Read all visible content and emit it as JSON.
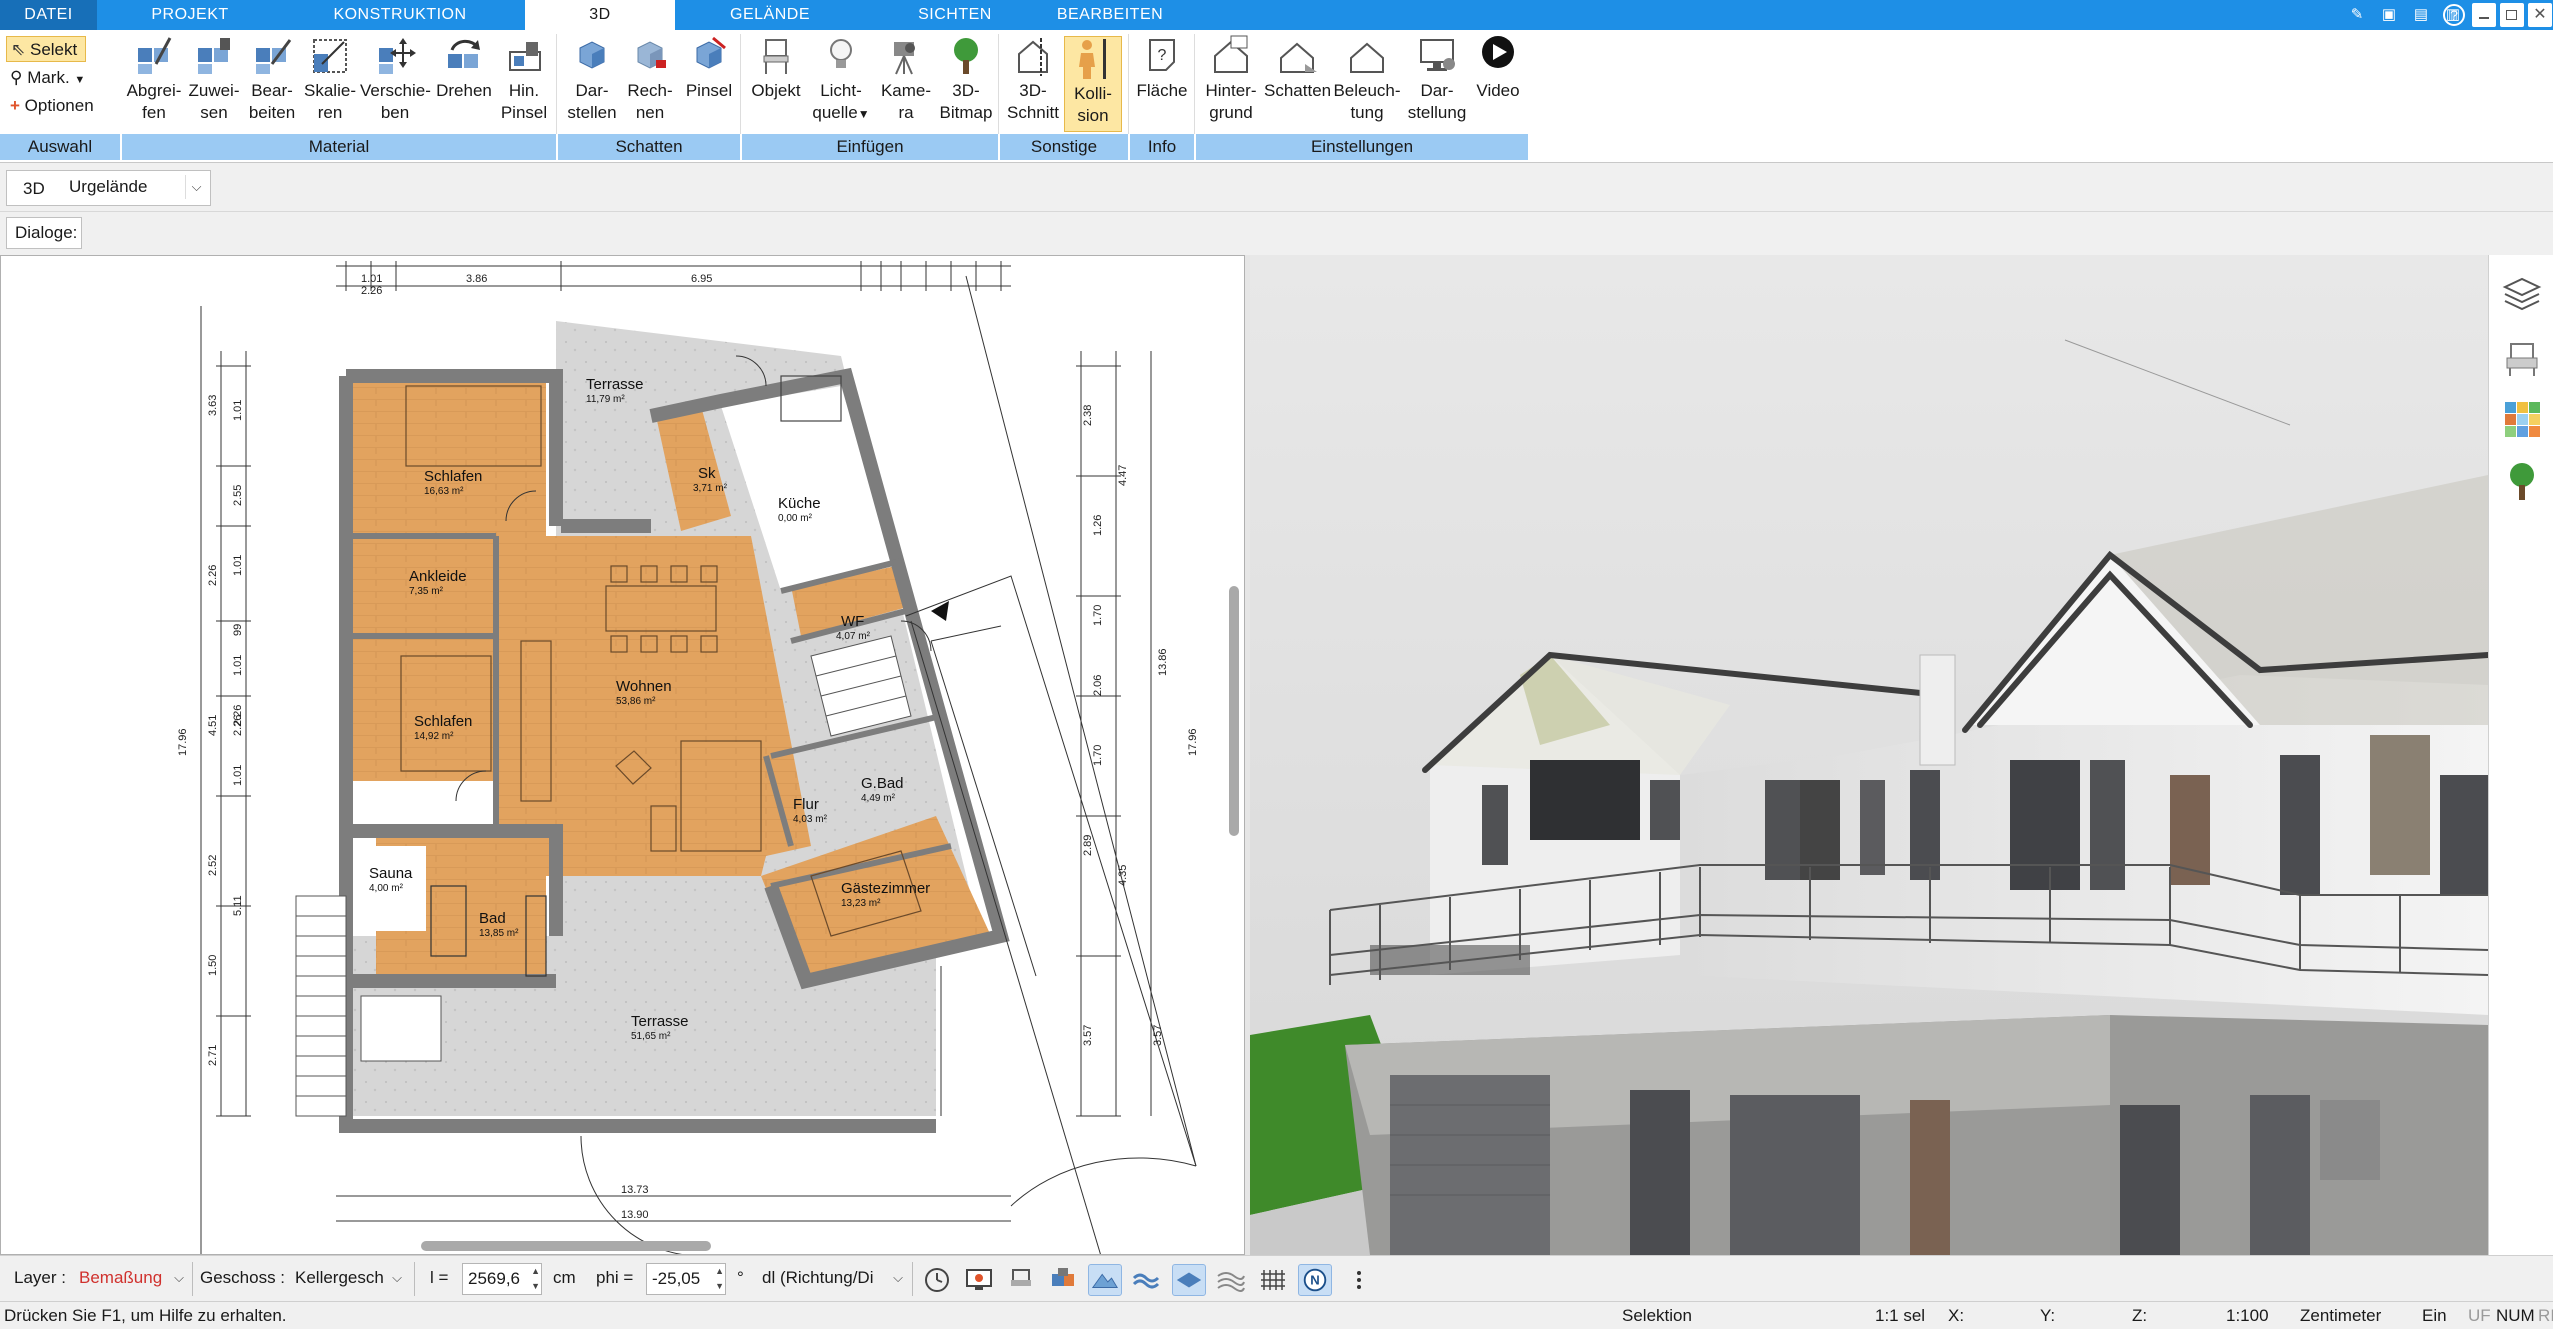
{
  "tabs": {
    "file": "DATEI",
    "items": [
      "PROJEKT",
      "KONSTRUKTION",
      "3D",
      "GELÄNDE",
      "SICHTEN",
      "BEARBEITEN"
    ],
    "active": "3D"
  },
  "ribbon": {
    "auswahl": {
      "select": "Selekt",
      "mark": "Mark.",
      "options": "Optionen",
      "group": "Auswahl"
    },
    "material": {
      "group": "Material",
      "buttons": [
        {
          "l1": "Abgrei-",
          "l2": "fen"
        },
        {
          "l1": "Zuwei-",
          "l2": "sen"
        },
        {
          "l1": "Bear-",
          "l2": "beiten"
        },
        {
          "l1": "Skalie-",
          "l2": "ren"
        },
        {
          "l1": "Verschie-",
          "l2": "ben"
        },
        {
          "l1": "Drehen",
          "l2": ""
        },
        {
          "l1": "Hin.",
          "l2": "Pinsel"
        }
      ]
    },
    "schatten": {
      "group": "Schatten",
      "buttons": [
        {
          "l1": "Dar-",
          "l2": "stellen"
        },
        {
          "l1": "Rech-",
          "l2": "nen"
        },
        {
          "l1": "Pinsel",
          "l2": ""
        }
      ]
    },
    "einfuegen": {
      "group": "Einfügen",
      "buttons": [
        {
          "l1": "Objekt",
          "l2": ""
        },
        {
          "l1": "Licht-",
          "l2": "quelle"
        },
        {
          "l1": "Kame-",
          "l2": "ra"
        },
        {
          "l1": "3D-",
          "l2": "Bitmap"
        }
      ]
    },
    "sonstige": {
      "group": "Sonstige",
      "buttons": [
        {
          "l1": "3D-",
          "l2": "Schnitt"
        },
        {
          "l1": "Kolli-",
          "l2": "sion"
        }
      ]
    },
    "info": {
      "group": "Info",
      "buttons": [
        {
          "l1": "Fläche",
          "l2": ""
        }
      ]
    },
    "einstellungen": {
      "group": "Einstellungen",
      "buttons": [
        {
          "l1": "Hinter-",
          "l2": "grund"
        },
        {
          "l1": "Schatten",
          "l2": ""
        },
        {
          "l1": "Beleuch-",
          "l2": "tung"
        },
        {
          "l1": "Dar-",
          "l2": "stellung"
        },
        {
          "l1": "Video",
          "l2": ""
        }
      ]
    }
  },
  "toolbar2": {
    "view_label": "3D",
    "terrain_select": "Urgelände"
  },
  "toolbar3": {
    "dialoge_label": "Dialoge:"
  },
  "plan": {
    "rooms": [
      {
        "name": "Terrasse",
        "area": "11,79 m²"
      },
      {
        "name": "Schlafen",
        "area": "16,63 m²"
      },
      {
        "name": "Sk",
        "area": "3,71 m²"
      },
      {
        "name": "Küche",
        "area": "0,00 m²"
      },
      {
        "name": "Ankleide",
        "area": "7,35 m²"
      },
      {
        "name": "Wohnen",
        "area": "53,86 m²"
      },
      {
        "name": "WF",
        "area": "4,07 m²"
      },
      {
        "name": "Schlafen",
        "area": "14,92 m²"
      },
      {
        "name": "G.Bad",
        "area": "4,49 m²"
      },
      {
        "name": "Flur",
        "area": "4,03 m²"
      },
      {
        "name": "Sauna",
        "area": "4,00 m²"
      },
      {
        "name": "Gästezimmer",
        "area": "13,23 m²"
      },
      {
        "name": "Bad",
        "area": "13,85 m²"
      },
      {
        "name": "Terrasse",
        "area": "51,65 m²"
      }
    ],
    "dims_top": [
      "1.01",
      "2.26",
      "3.86",
      "6.95"
    ],
    "dims_bottom": [
      "13.73",
      "13.90"
    ],
    "dims_left": [
      "3.63",
      "1.01",
      "2.55",
      "2.26",
      "1.01",
      "99",
      "1.01",
      "2.26",
      "4.51",
      "1.01",
      "2.26",
      "2.52",
      "5.11",
      "1.50",
      "2.71",
      "17.96"
    ],
    "dims_right": [
      "2.38",
      "4.47",
      "1.26",
      "1.70",
      "2.06",
      "1.70",
      "2.89",
      "4.35",
      "3.57",
      "3.57",
      "13.86",
      "17.96"
    ]
  },
  "bottombar": {
    "layer_label": "Layer :",
    "layer_value": "Bemaßung",
    "layer_color": "#d0312d",
    "geschoss_label": "Geschoss :",
    "geschoss_value": "Kellergesch",
    "l_label": "l =",
    "l_value": "2569,6",
    "l_unit": "cm",
    "phi_label": "phi =",
    "phi_value": "-25,05",
    "phi_unit": "°",
    "dl_value": "dl (Richtung/Di"
  },
  "statusbar": {
    "help": "Drücken Sie F1, um Hilfe zu erhalten.",
    "mode": "Selektion",
    "sel": "1:1 sel",
    "x": "X:",
    "y": "Y:",
    "z": "Z:",
    "scale": "1:100",
    "unit": "Zentimeter",
    "ein": "Ein",
    "uf": "UF",
    "num": "NUM",
    "ri": "RI"
  },
  "colors": {
    "tab_bar": "#1e8fe6",
    "group_label": "#9bcaf3",
    "selected_button": "#fde7a3",
    "floor_wood": "#e2a35f",
    "wall": "#8a8a8a"
  }
}
